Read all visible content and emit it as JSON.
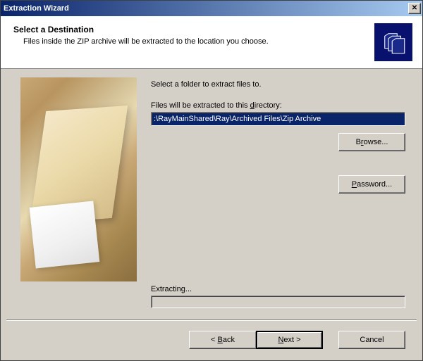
{
  "titlebar": {
    "title": "Extraction Wizard"
  },
  "header": {
    "title": "Select a Destination",
    "description": "Files inside the ZIP archive will be extracted to the location you choose."
  },
  "form": {
    "instruction": "Select a folder to extract files to.",
    "directory_label_pre": "Files will be extracted to this ",
    "directory_label_u": "d",
    "directory_label_post": "irectory:",
    "directory_value": ":\\RayMainShared\\Ray\\Archived Files\\Zip Archive",
    "browse_pre": "B",
    "browse_u": "r",
    "browse_post": "owse...",
    "password_u": "P",
    "password_post": "assword...",
    "extracting_label": "Extracting..."
  },
  "footer": {
    "back_pre": "< ",
    "back_u": "B",
    "back_post": "ack",
    "next_u": "N",
    "next_post": "ext >",
    "cancel": "Cancel"
  },
  "colors": {
    "accent": "#0a246a",
    "face": "#d4d0c8"
  }
}
